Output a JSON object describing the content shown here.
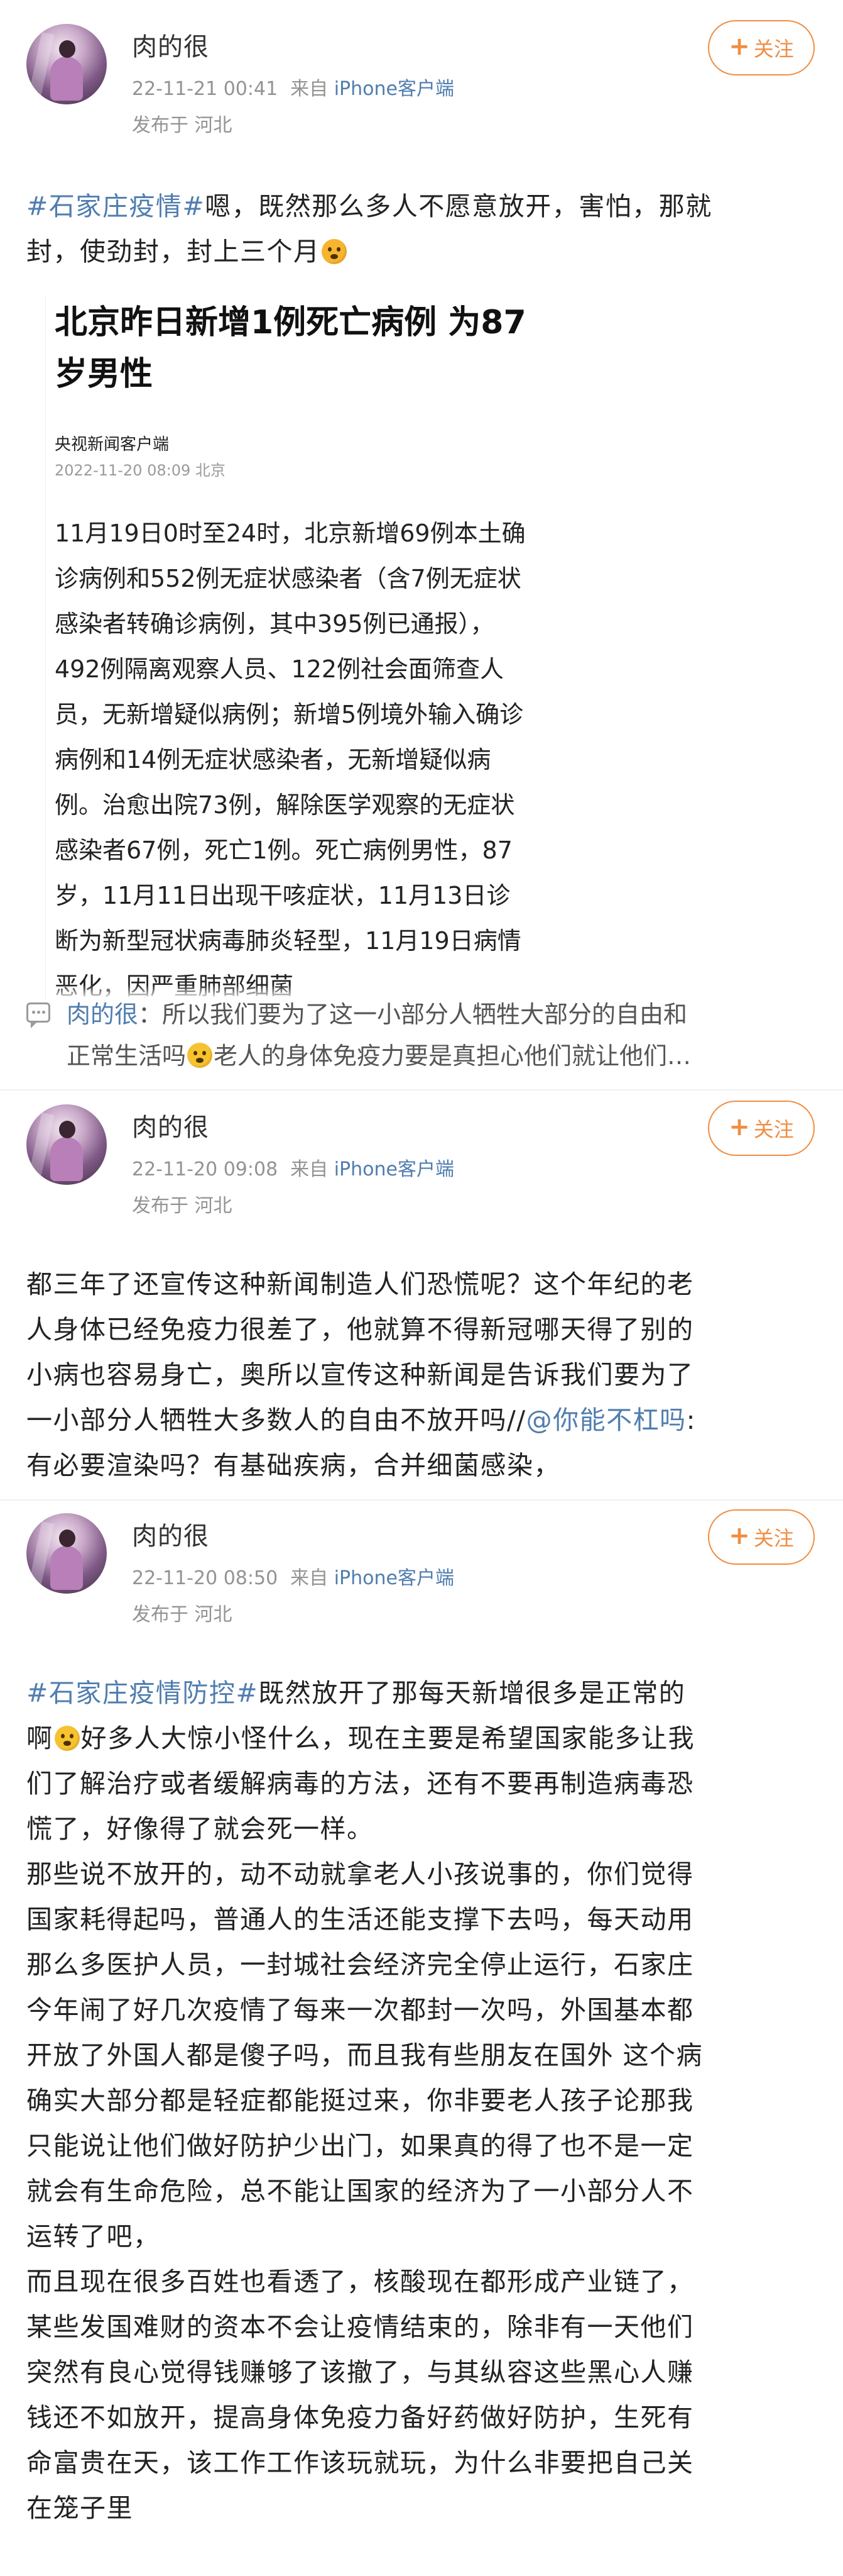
{
  "posts": [
    {
      "author": "肉的很",
      "time": "22-11-21 00:41",
      "source_prefix": "来自",
      "source_app": "iPhone客户端",
      "location": "发布于 河北",
      "follow_label": "关注",
      "text": {
        "hashtag": "#石家庄疫情#",
        "line1_rest": "嗯，既然那么多人不愿意放开，害怕，那就",
        "line2": "封，使劲封，封上三个月"
      },
      "article": {
        "title": "北京昨日新增1例死亡病例 为87岁男性",
        "source": "央视新闻客户端",
        "time": "2022-11-20 08:09 北京",
        "body": "11月19日0时至24时，北京新增69例本土确诊病例和552例无症状感染者（含7例无症状感染者转确诊病例，其中395例已通报），492例隔离观察人员、122例社会面筛查人员，无新增疑似病例；新增5例境外输入确诊病例和14例无症状感染者，无新增疑似病例。治愈出院73例，解除医学观察的无症状感染者67例，死亡1例。死亡病例男性，87岁，11月11日出现干咳症状，11月13日诊断为新型冠状病毒肺炎轻型，11月19日病情恶化，因严重肺部细菌"
      },
      "comment": {
        "name": "肉的很",
        "line1": "：所以我们要为了这一小部分人牺牲大部分的自由和",
        "line2a": "正常生活吗",
        "line2b": "老人的身体免疫力要是真担心他们就让他们…"
      }
    },
    {
      "author": "肉的很",
      "time": "22-11-20 09:08",
      "source_prefix": "来自",
      "source_app": "iPhone客户端",
      "location": "发布于 河北",
      "follow_label": "关注",
      "text": {
        "line1": "都三年了还宣传这种新闻制造人们恐慌呢？这个年纪的老",
        "line2": "人身体已经免疫力很差了，他就算不得新冠哪天得了别的",
        "line3": "小病也容易身亡，奥所以宣传这种新闻是告诉我们要为了",
        "line4a": "一小部分人牺牲大多数人的自由不放开吗//",
        "mention": "@你能不杠吗",
        "line4b": ":",
        "line5": "有必要渲染吗？有基础疾病，合并细菌感染，"
      }
    },
    {
      "author": "肉的很",
      "time": "22-11-20 08:50",
      "source_prefix": "来自",
      "source_app": "iPhone客户端",
      "location": "发布于 河北",
      "follow_label": "关注",
      "text": {
        "hashtag": "#石家庄疫情防控#",
        "line1_rest": "既然放开了那每天新增很多是正常的",
        "line2a": "啊",
        "line2b": "好多人大惊小怪什么，现在主要是希望国家能多让我",
        "line3": "们了解治疗或者缓解病毒的方法，还有不要再制造病毒恐",
        "line4": "慌了，好像得了就会死一样。",
        "line5": "那些说不放开的，动不动就拿老人小孩说事的，你们觉得",
        "line6": "国家耗得起吗，普通人的生活还能支撑下去吗，每天动用",
        "line7": "那么多医护人员，一封城社会经济完全停止运行，石家庄",
        "line8": "今年闹了好几次疫情了每来一次都封一次吗，外国基本都",
        "line9": "开放了外国人都是傻子吗，而且我有些朋友在国外 这个病",
        "line10": "确实大部分都是轻症都能挺过来，你非要老人孩子论那我",
        "line11": "只能说让他们做好防护少出门，如果真的得了也不是一定",
        "line12": "就会有生命危险，总不能让国家的经济为了一小部分人不",
        "line13": "运转了吧，",
        "line14": "而且现在很多百姓也看透了，核酸现在都形成产业链了，",
        "line15": "某些发国难财的资本不会让疫情结束的，除非有一天他们",
        "line16": "突然有良心觉得钱赚够了该撤了，与其纵容这些黑心人赚",
        "line17": "钱还不如放开，提高身体免疫力备好药做好防护，生死有",
        "line18": "命富贵在天，该工作工作该玩就玩，为什么非要把自己关",
        "line19": "在笼子里"
      }
    }
  ]
}
